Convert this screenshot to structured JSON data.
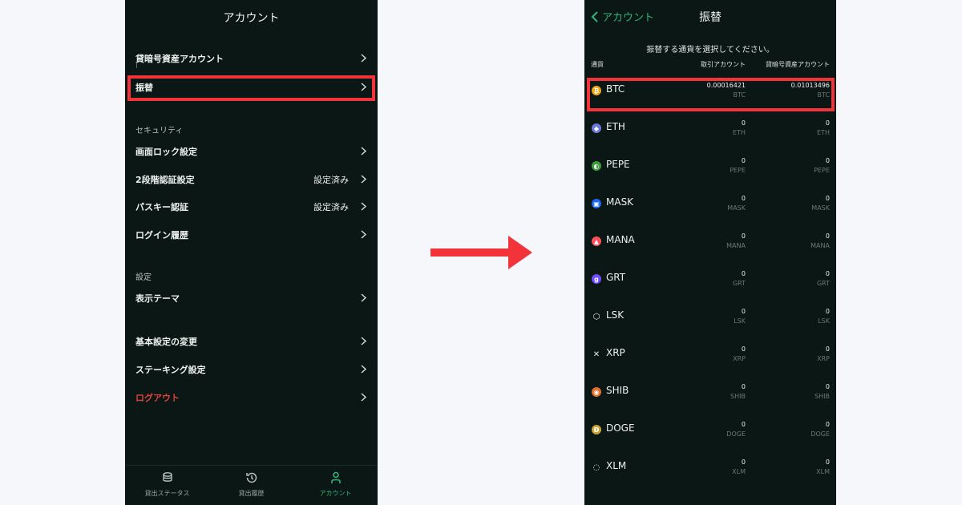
{
  "left": {
    "title": "アカウント",
    "menu": {
      "lending_account": {
        "label": "貸暗号資産アカウント",
        "sub": "|"
      },
      "transfer": {
        "label": "振替"
      },
      "security_section": "セキュリティ",
      "screen_lock": {
        "label": "画面ロック設定"
      },
      "two_factor": {
        "label": "2段階認証設定",
        "value": "設定済み"
      },
      "passkey": {
        "label": "パスキー認証",
        "value": "設定済み"
      },
      "login_history": {
        "label": "ログイン履歴"
      },
      "settings_section": "設定",
      "theme": {
        "label": "表示テーマ"
      },
      "basic_settings": {
        "label": "基本設定の変更"
      },
      "staking": {
        "label": "ステーキング設定"
      },
      "logout": {
        "label": "ログアウト"
      }
    },
    "nav": [
      {
        "label": "貸出ステータス",
        "icon": "coins-icon"
      },
      {
        "label": "貸出履歴",
        "icon": "history-icon"
      },
      {
        "label": "アカウント",
        "icon": "person-icon"
      }
    ]
  },
  "right": {
    "back_label": "アカウント",
    "title": "振替",
    "instruction": "振替する通貨を選択してください。",
    "columns": {
      "currency": "通貨",
      "trading": "取引アカウント",
      "lending": "貸暗号資産アカウント"
    },
    "coins": [
      {
        "name": "BTC",
        "trading": "0.00016421",
        "lending": "0.01013496",
        "unit": "BTC",
        "color": "#f2a51a",
        "glyph": "₿"
      },
      {
        "name": "ETH",
        "trading": "0",
        "lending": "0",
        "unit": "ETH",
        "color": "#6b7bd6",
        "glyph": "◆"
      },
      {
        "name": "PEPE",
        "trading": "0",
        "lending": "0",
        "unit": "PEPE",
        "color": "#3f9b3b",
        "glyph": "◐"
      },
      {
        "name": "MASK",
        "trading": "0",
        "lending": "0",
        "unit": "MASK",
        "color": "#1c68f3",
        "glyph": "▣"
      },
      {
        "name": "MANA",
        "trading": "0",
        "lending": "0",
        "unit": "MANA",
        "color": "#ff4f5a",
        "glyph": "▲"
      },
      {
        "name": "GRT",
        "trading": "0",
        "lending": "0",
        "unit": "GRT",
        "color": "#6f4cff",
        "glyph": "g"
      },
      {
        "name": "LSK",
        "trading": "0",
        "lending": "0",
        "unit": "LSK",
        "color": "#0b1714",
        "glyph": "⬡"
      },
      {
        "name": "XRP",
        "trading": "0",
        "lending": "0",
        "unit": "XRP",
        "color": "#0b1714",
        "glyph": "✕"
      },
      {
        "name": "SHIB",
        "trading": "0",
        "lending": "0",
        "unit": "SHIB",
        "color": "#e2702b",
        "glyph": "◉"
      },
      {
        "name": "DOGE",
        "trading": "0",
        "lending": "0",
        "unit": "DOGE",
        "color": "#c3a634",
        "glyph": "Ð"
      },
      {
        "name": "XLM",
        "trading": "0",
        "lending": "0",
        "unit": "XLM",
        "color": "#0b1714",
        "glyph": "◌"
      }
    ]
  }
}
